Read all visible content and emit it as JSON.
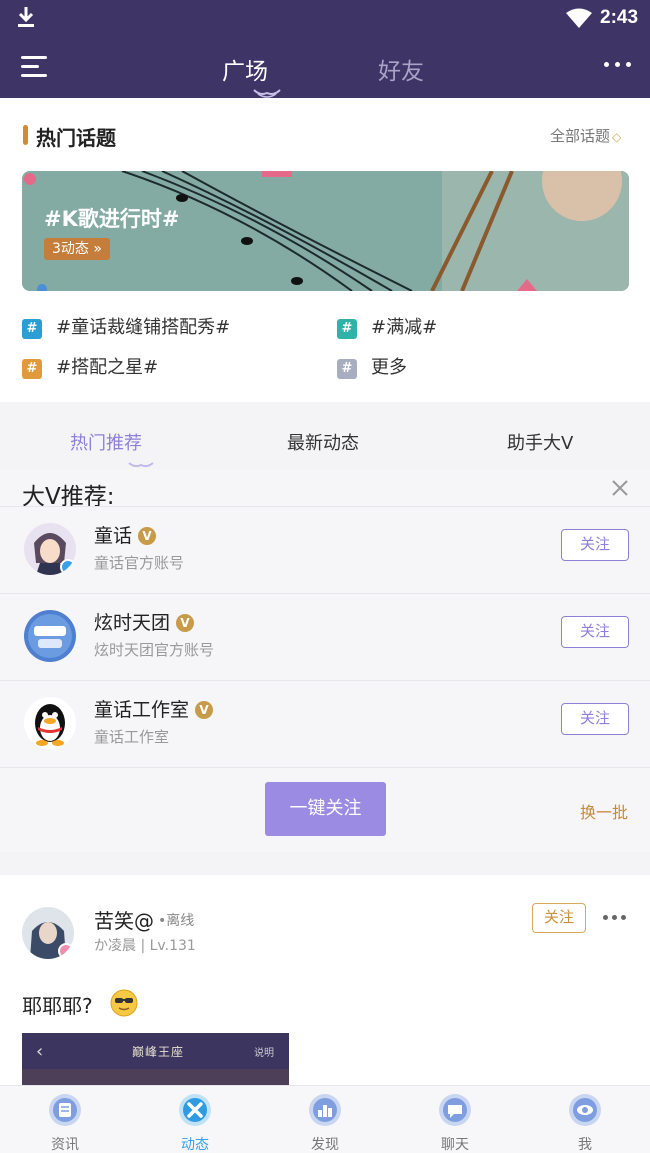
{
  "status_bar": {
    "time": "2:43"
  },
  "header": {
    "tabs": [
      {
        "label": "广场",
        "active": true
      },
      {
        "label": "好友",
        "active": false
      }
    ]
  },
  "hot_topics": {
    "title": "热门话题",
    "all_link": "全部话题",
    "banner": {
      "title": "#K歌进行时#",
      "badge": "3动态"
    },
    "topics": [
      {
        "label": "#童话裁缝铺搭配秀#",
        "color": "#2b9fd4"
      },
      {
        "label": "#满减#",
        "color": "#2fb3a8"
      },
      {
        "label": "#搭配之星#",
        "color": "#e09a3c"
      },
      {
        "label": "更多",
        "color": "#a9adc0"
      }
    ]
  },
  "sub_tabs": [
    {
      "label": "热门推荐",
      "active": true
    },
    {
      "label": "最新动态",
      "active": false
    },
    {
      "label": "助手大V",
      "active": false
    }
  ],
  "recommend": {
    "title": "大V推荐:",
    "follow_label": "关注",
    "users": [
      {
        "name": "童话",
        "desc": "童话官方账号",
        "badge": "V"
      },
      {
        "name": "炫时天团",
        "desc": "炫时天团官方账号",
        "badge": "V"
      },
      {
        "name": "童话工作室",
        "desc": "童话工作室",
        "badge": "V"
      }
    ],
    "one_key_follow": "一键关注",
    "swap": "换一批"
  },
  "post": {
    "name": "苦笑@",
    "status": "•离线",
    "meta": "か凌晨 | Lv.131",
    "follow": "关注",
    "text": "耶耶耶?",
    "image": {
      "title": "巅峰王座",
      "right": "说明"
    }
  },
  "bottom_nav": [
    {
      "label": "资讯",
      "active": false
    },
    {
      "label": "动态",
      "active": true
    },
    {
      "label": "发现",
      "active": false
    },
    {
      "label": "聊天",
      "active": false
    },
    {
      "label": "我",
      "active": false
    }
  ],
  "colors": {
    "header_bg": "#3e3566",
    "accent_purple": "#8f7fd6",
    "accent_gold": "#c89b4a",
    "active_blue": "#3aa0e6"
  }
}
